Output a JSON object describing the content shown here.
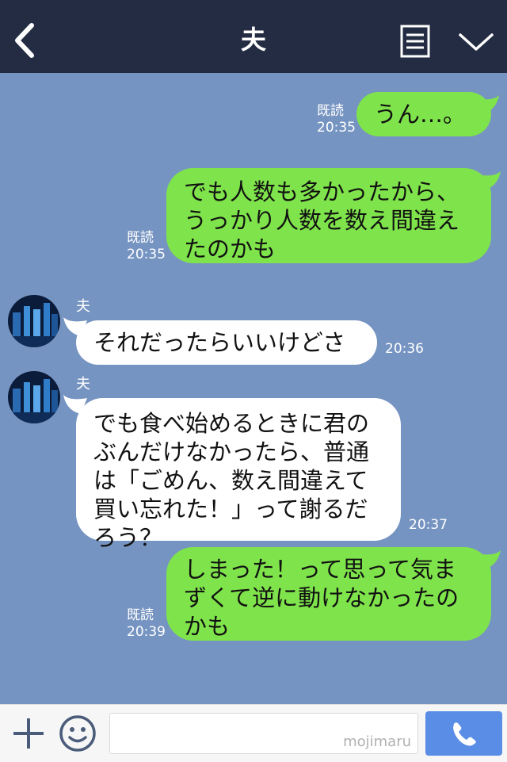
{
  "header": {
    "title": "夫"
  },
  "messages": [
    {
      "side": "mine",
      "text": "うん…。",
      "read": "既読",
      "time": "20:35"
    },
    {
      "side": "mine",
      "lines": [
        "でも人数も多かったから、",
        "うっかり人数を数え間違え",
        "たのかも"
      ],
      "read": "既読",
      "time": "20:35"
    },
    {
      "side": "theirs",
      "sender": "夫",
      "text": "それだったらいいけどさ",
      "time": "20:36"
    },
    {
      "side": "theirs",
      "sender": "夫",
      "lines": [
        "でも食べ始めるときに君の",
        "ぶんだけなかったら、普通",
        "は「ごめん、数え間違えて",
        "買い忘れた！」って謝るだ",
        "ろう？"
      ],
      "time": "20:37"
    },
    {
      "side": "mine",
      "lines": [
        "しまった！って思って気ま",
        "ずくて逆に動けなかったの",
        "かも"
      ],
      "read": "既読",
      "time": "20:39"
    }
  ],
  "footer": {
    "watermark": "mojimaru"
  },
  "colors": {
    "header_bg": "#232c43",
    "chat_bg": "#7694c1",
    "my_bubble": "#7fe34b",
    "their_bubble": "#ffffff",
    "call_button": "#5a8ee6"
  }
}
